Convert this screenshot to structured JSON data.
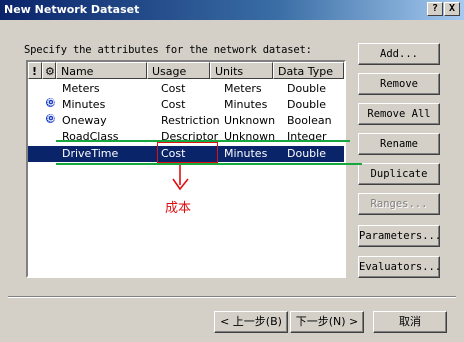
{
  "window": {
    "title": "New Network Dataset",
    "help_btn": "?",
    "close_btn": "X"
  },
  "instruction": "Specify the attributes for the network dataset:",
  "table": {
    "headers": [
      "!",
      "⚙",
      "Name",
      "Usage",
      "Units",
      "Data Type"
    ],
    "rows": [
      {
        "flag": "",
        "name": "Meters",
        "usage": "Cost",
        "units": "Meters",
        "type": "Double"
      },
      {
        "flag": "⚙",
        "name": "Minutes",
        "usage": "Cost",
        "units": "Minutes",
        "type": "Double"
      },
      {
        "flag": "⚙",
        "name": "Oneway",
        "usage": "Restriction",
        "units": "Unknown",
        "type": "Boolean"
      },
      {
        "flag": "",
        "name": "RoadClass",
        "usage": "Descriptor",
        "units": "Unknown",
        "type": "Integer"
      },
      {
        "flag": "",
        "name": "DriveTime",
        "usage": "Cost",
        "units": "Minutes",
        "type": "Double",
        "selected": true
      }
    ]
  },
  "side_buttons": {
    "add": "Add...",
    "remove": "Remove",
    "remove_all": "Remove All",
    "rename": "Rename",
    "duplicate": "Duplicate",
    "ranges": "Ranges...",
    "parameters": "Parameters...",
    "evaluators": "Evaluators..."
  },
  "bottom_buttons": {
    "back": "< 上一步(B)",
    "next": "下一步(N) >",
    "cancel": "取消"
  },
  "annotation": {
    "label": "成本",
    "color": "#e01010",
    "line_color": "#16a83e"
  }
}
